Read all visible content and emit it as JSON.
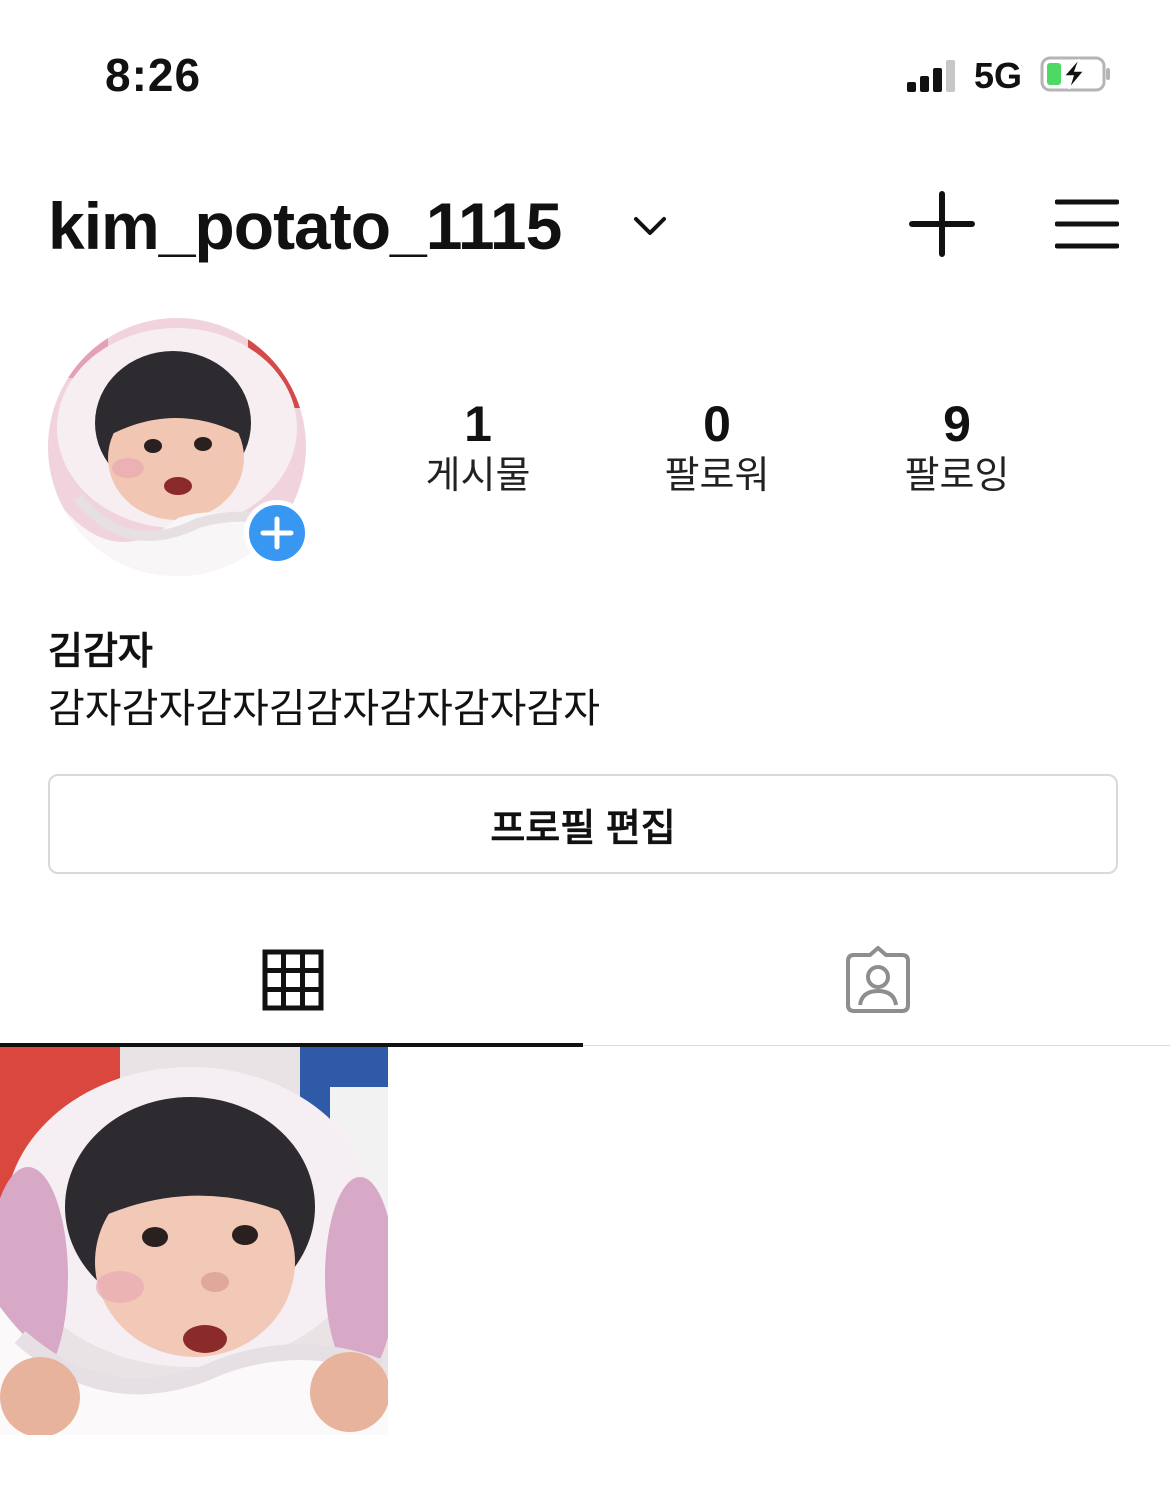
{
  "status_bar": {
    "time": "8:26",
    "network": "5G",
    "battery_icon": "battery-charging-icon",
    "signal_icon": "cellular-signal-icon"
  },
  "header": {
    "username": "kim_potato_1115",
    "account_switch_icon": "chevron-down-icon",
    "new_post_icon": "plus-icon",
    "menu_icon": "hamburger-menu-icon"
  },
  "profile": {
    "add_story_icon": "plus-icon",
    "stats": [
      {
        "value": "1",
        "label": "게시물"
      },
      {
        "value": "0",
        "label": "팔로워"
      },
      {
        "value": "9",
        "label": "팔로잉"
      }
    ],
    "display_name": "김감자",
    "bio": "감자감자감자김감자감자감자감자"
  },
  "actions": {
    "edit_profile": "프로필 편집"
  },
  "tabs": [
    {
      "icon": "grid-icon",
      "active": true
    },
    {
      "icon": "tagged-person-icon",
      "active": false
    }
  ],
  "colors": {
    "accent_blue": "#3897f0",
    "battery_green": "#4cd964",
    "border": "#dbdbdb"
  }
}
